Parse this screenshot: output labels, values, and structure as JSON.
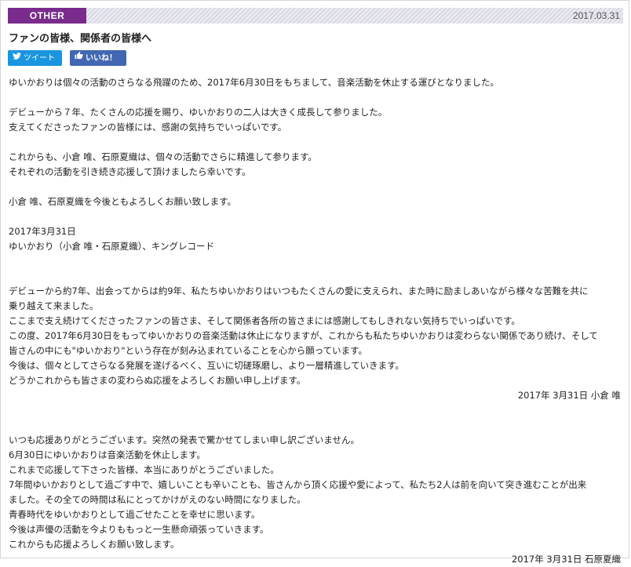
{
  "header": {
    "category": "OTHER",
    "date": "2017.03.31"
  },
  "title": "ファンの皆様、関係者の皆様へ",
  "social": {
    "tweet_label": "ツイート",
    "like_label": "いいね！"
  },
  "announcement": {
    "p1": "ゆいかおりは個々の活動のさらなる飛躍のため、2017年6月30日をもちまして、音楽活動を休止する運びとなりました。",
    "p2a": "デビューから７年、たくさんの応援を賜り、ゆいかおりの二人は大きく成長して参りました。",
    "p2b": "支えてくださったファンの皆様には、感謝の気持ちでいっぱいです。",
    "p3a": "これからも、小倉 唯、石原夏織は、個々の活動でさらに精進して参ります。",
    "p3b": "それぞれの活動を引き続き応援して頂けましたら幸いです。",
    "p4": "小倉 唯、石原夏織を今後ともよろしくお願い致します。",
    "date_line": "2017年3月31日",
    "signature": "ゆいかおり（小倉 唯・石原夏織）、キングレコード"
  },
  "message_yui": {
    "lines": [
      "デビューから約7年、出会ってからは約9年、私たちゆいかおりはいつもたくさんの愛に支えられ、また時に励ましあいながら様々な苦難を共に",
      "乗り越えて来ました。",
      "ここまで支え続けてくださったファンの皆さま、そして関係者各所の皆さまには感謝してもしきれない気持ちでいっぱいです。",
      "この度、2017年6月30日をもってゆいかおりの音楽活動は休止になりますが、これからも私たちゆいかおりは変わらない関係であり続け、そして",
      "皆さんの中にも\"ゆいかおり\"という存在が刻み込まれていることを心から願っています。",
      "今後は、個々としてさらなる発展を遂げるべく、互いに切磋琢磨し、より一層精進していきます。",
      "どうかこれからも皆さまの変わらぬ応援をよろしくお願い申し上げます。"
    ],
    "signature": "2017年 3月31日 小倉 唯"
  },
  "message_kaori": {
    "lines": [
      "いつも応援ありがとうございます。突然の発表で驚かせてしまい申し訳ございません。",
      "6月30日にゆいかおりは音楽活動を休止します。",
      "これまで応援して下さった皆様、本当にありがとうございました。",
      "7年間ゆいかおりとして過ごす中で、嬉しいことも辛いことも、皆さんから頂く応援や愛によって、私たち2人は前を向いて突き進むことが出来",
      "ました。その全ての時間は私にとってかけがえのない時間になりました。",
      "青春時代をゆいかおりとして過ごせたことを幸せに思います。",
      "今後は声優の活動を今よりももっと一生懸命頑張っていきます。",
      "これからも応援よろしくお願い致します。"
    ],
    "signature": "2017年 3月31日 石原夏織"
  },
  "colors": {
    "category_bg": "#7a2c8c",
    "tweet_bg": "#1b95e0",
    "like_bg": "#4267b2"
  },
  "icons": {
    "tweet": "twitter-bird-icon",
    "like": "thumbs-up-icon"
  }
}
